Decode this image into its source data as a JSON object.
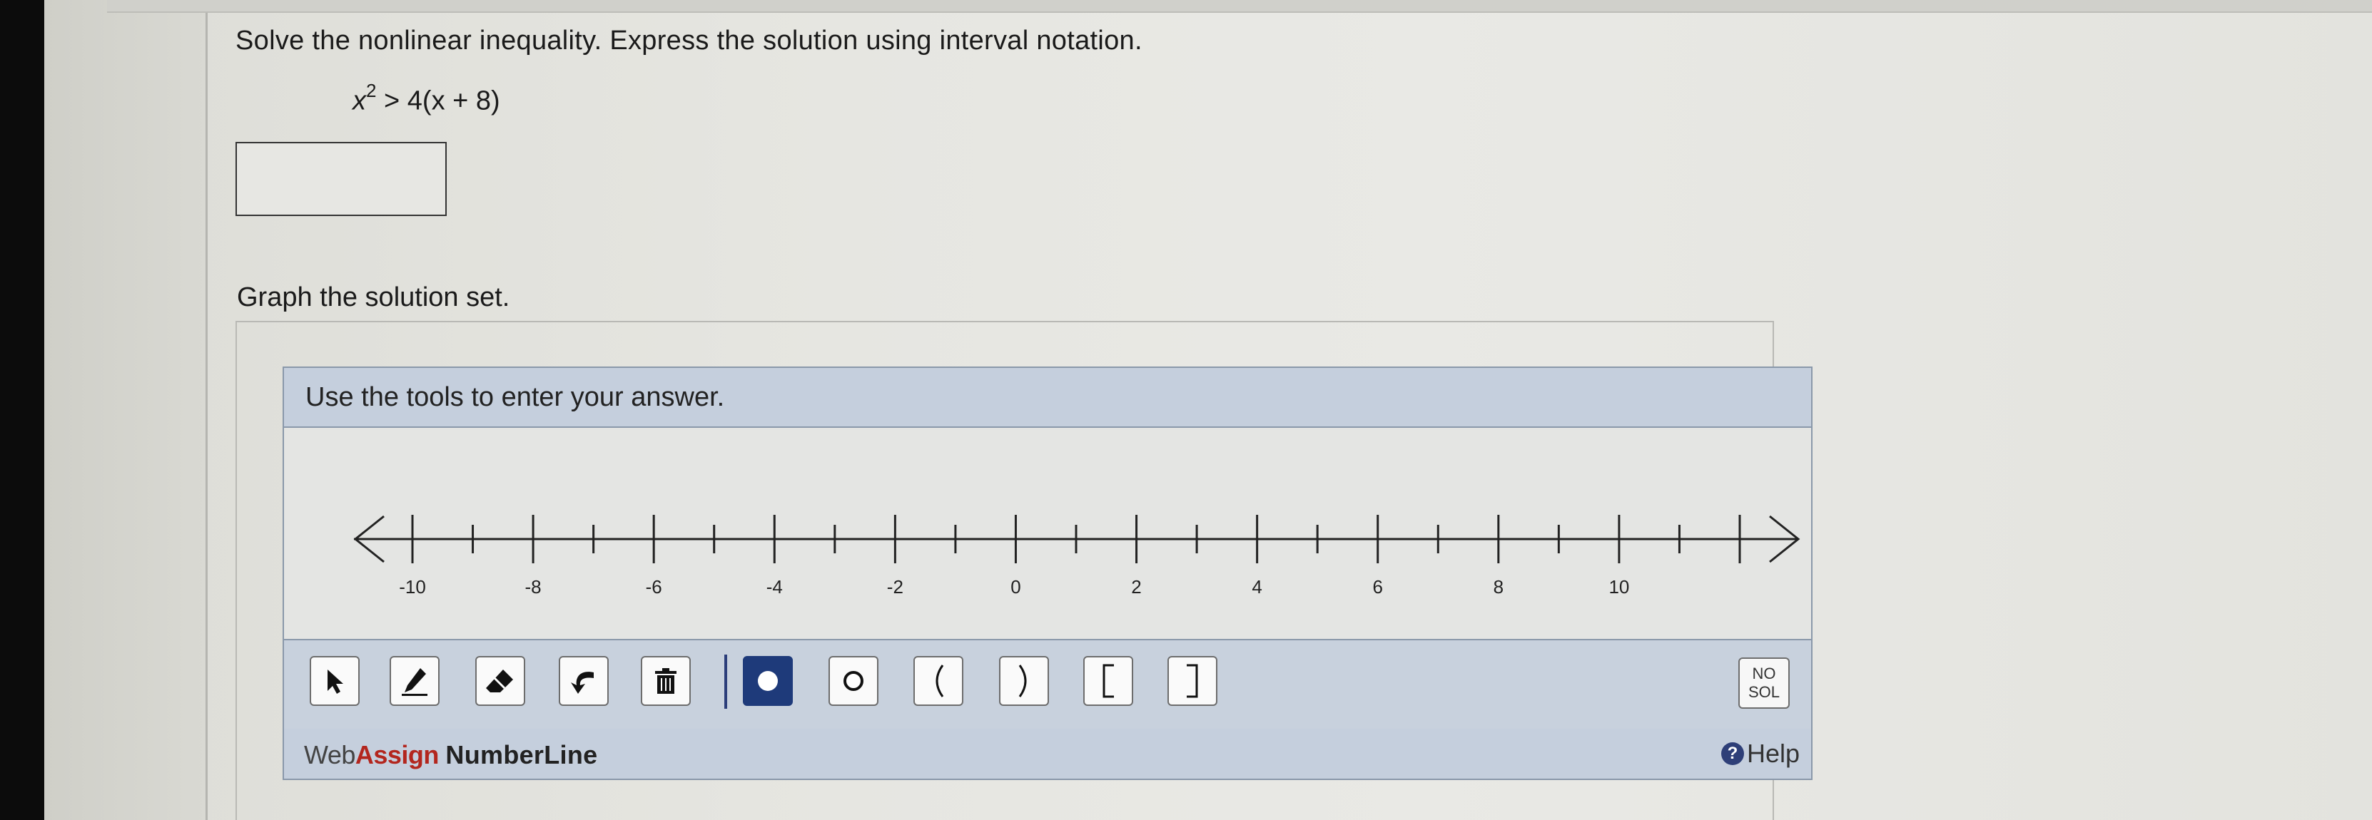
{
  "question": {
    "prompt": "Solve the nonlinear inequality. Express the solution using interval notation.",
    "equation": {
      "lhs_var": "x",
      "lhs_exp": "2",
      "rhs": "> 4(x + 8)"
    },
    "answer_value": ""
  },
  "graph": {
    "prompt": "Graph the solution set.",
    "instruction": "Use the tools to enter your answer.",
    "tick_labels": [
      "-10",
      "-8",
      "-6",
      "-4",
      "-2",
      "0",
      "2",
      "4",
      "6",
      "8",
      "10"
    ]
  },
  "toolbar": {
    "tools": [
      "pointer-icon",
      "pencil-icon",
      "eraser-icon",
      "undo-icon",
      "trash-icon",
      "closed-dot-icon",
      "open-dot-icon",
      "left-paren-icon",
      "right-paren-icon",
      "left-bracket-icon",
      "right-bracket-icon"
    ],
    "no_solution_line1": "NO",
    "no_solution_line2": "SOL"
  },
  "footer": {
    "brand_web": "Web",
    "brand_assign": "Assign",
    "brand_product": "NumberLine",
    "help": "Help"
  }
}
